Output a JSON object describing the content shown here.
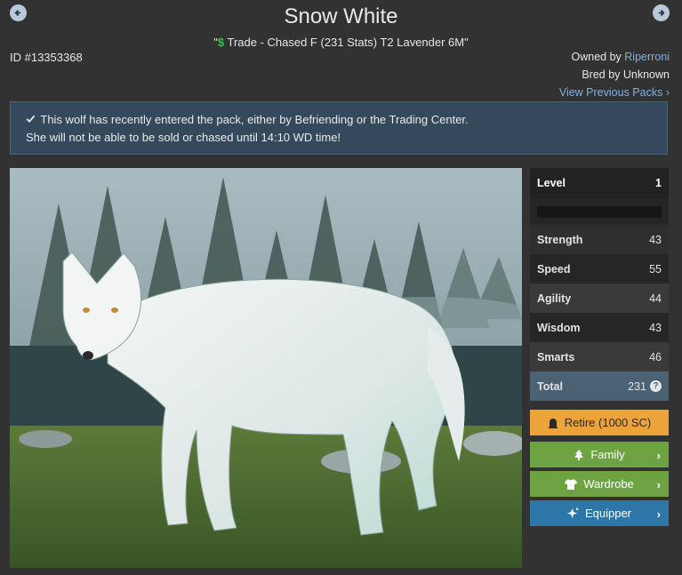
{
  "header": {
    "title": "Snow White",
    "subtitle_prefix": "\"",
    "subtitle_icon": "$",
    "subtitle_text": " Trade - Chased F (231 Stats) T2 Lavender 6M\"",
    "id_label": "ID #13353368",
    "owned_prefix": "Owned by ",
    "owner": "Riperroni",
    "bred_by": "Bred by Unknown",
    "view_previous": "View Previous Packs"
  },
  "icons": {
    "prev": "arrow-left-circle-icon",
    "next": "arrow-right-circle-icon",
    "check": "check-icon",
    "retire": "tombstone-icon",
    "family": "tree-icon",
    "wardrobe": "shirt-icon",
    "equipper": "sparkle-icon",
    "help": "question-circle-icon"
  },
  "notice": {
    "line1": "This wolf has recently entered the pack, either by Befriending or the Trading Center.",
    "line2": "She will not be able to be sold or chased until 14:10 WD time!"
  },
  "stats": {
    "level_label": "Level",
    "level_value": "1",
    "xp_fraction": 0,
    "rows": [
      {
        "label": "Strength",
        "value": "43"
      },
      {
        "label": "Speed",
        "value": "55"
      },
      {
        "label": "Agility",
        "value": "44"
      },
      {
        "label": "Wisdom",
        "value": "43"
      },
      {
        "label": "Smarts",
        "value": "46"
      }
    ],
    "total_label": "Total",
    "total_value": "231",
    "help_glyph": "?"
  },
  "buttons": {
    "retire": "Retire (1000 SC)",
    "family": "Family",
    "wardrobe": "Wardrobe",
    "equipper": "Equipper",
    "chevron": "›"
  },
  "colors": {
    "background": "#323232",
    "notice": "#34495c",
    "link": "#7fb0de",
    "retire": "#eba33a",
    "green_button": "#6ea343",
    "blue_button": "#2c77a8",
    "total_row": "#4a6274"
  }
}
